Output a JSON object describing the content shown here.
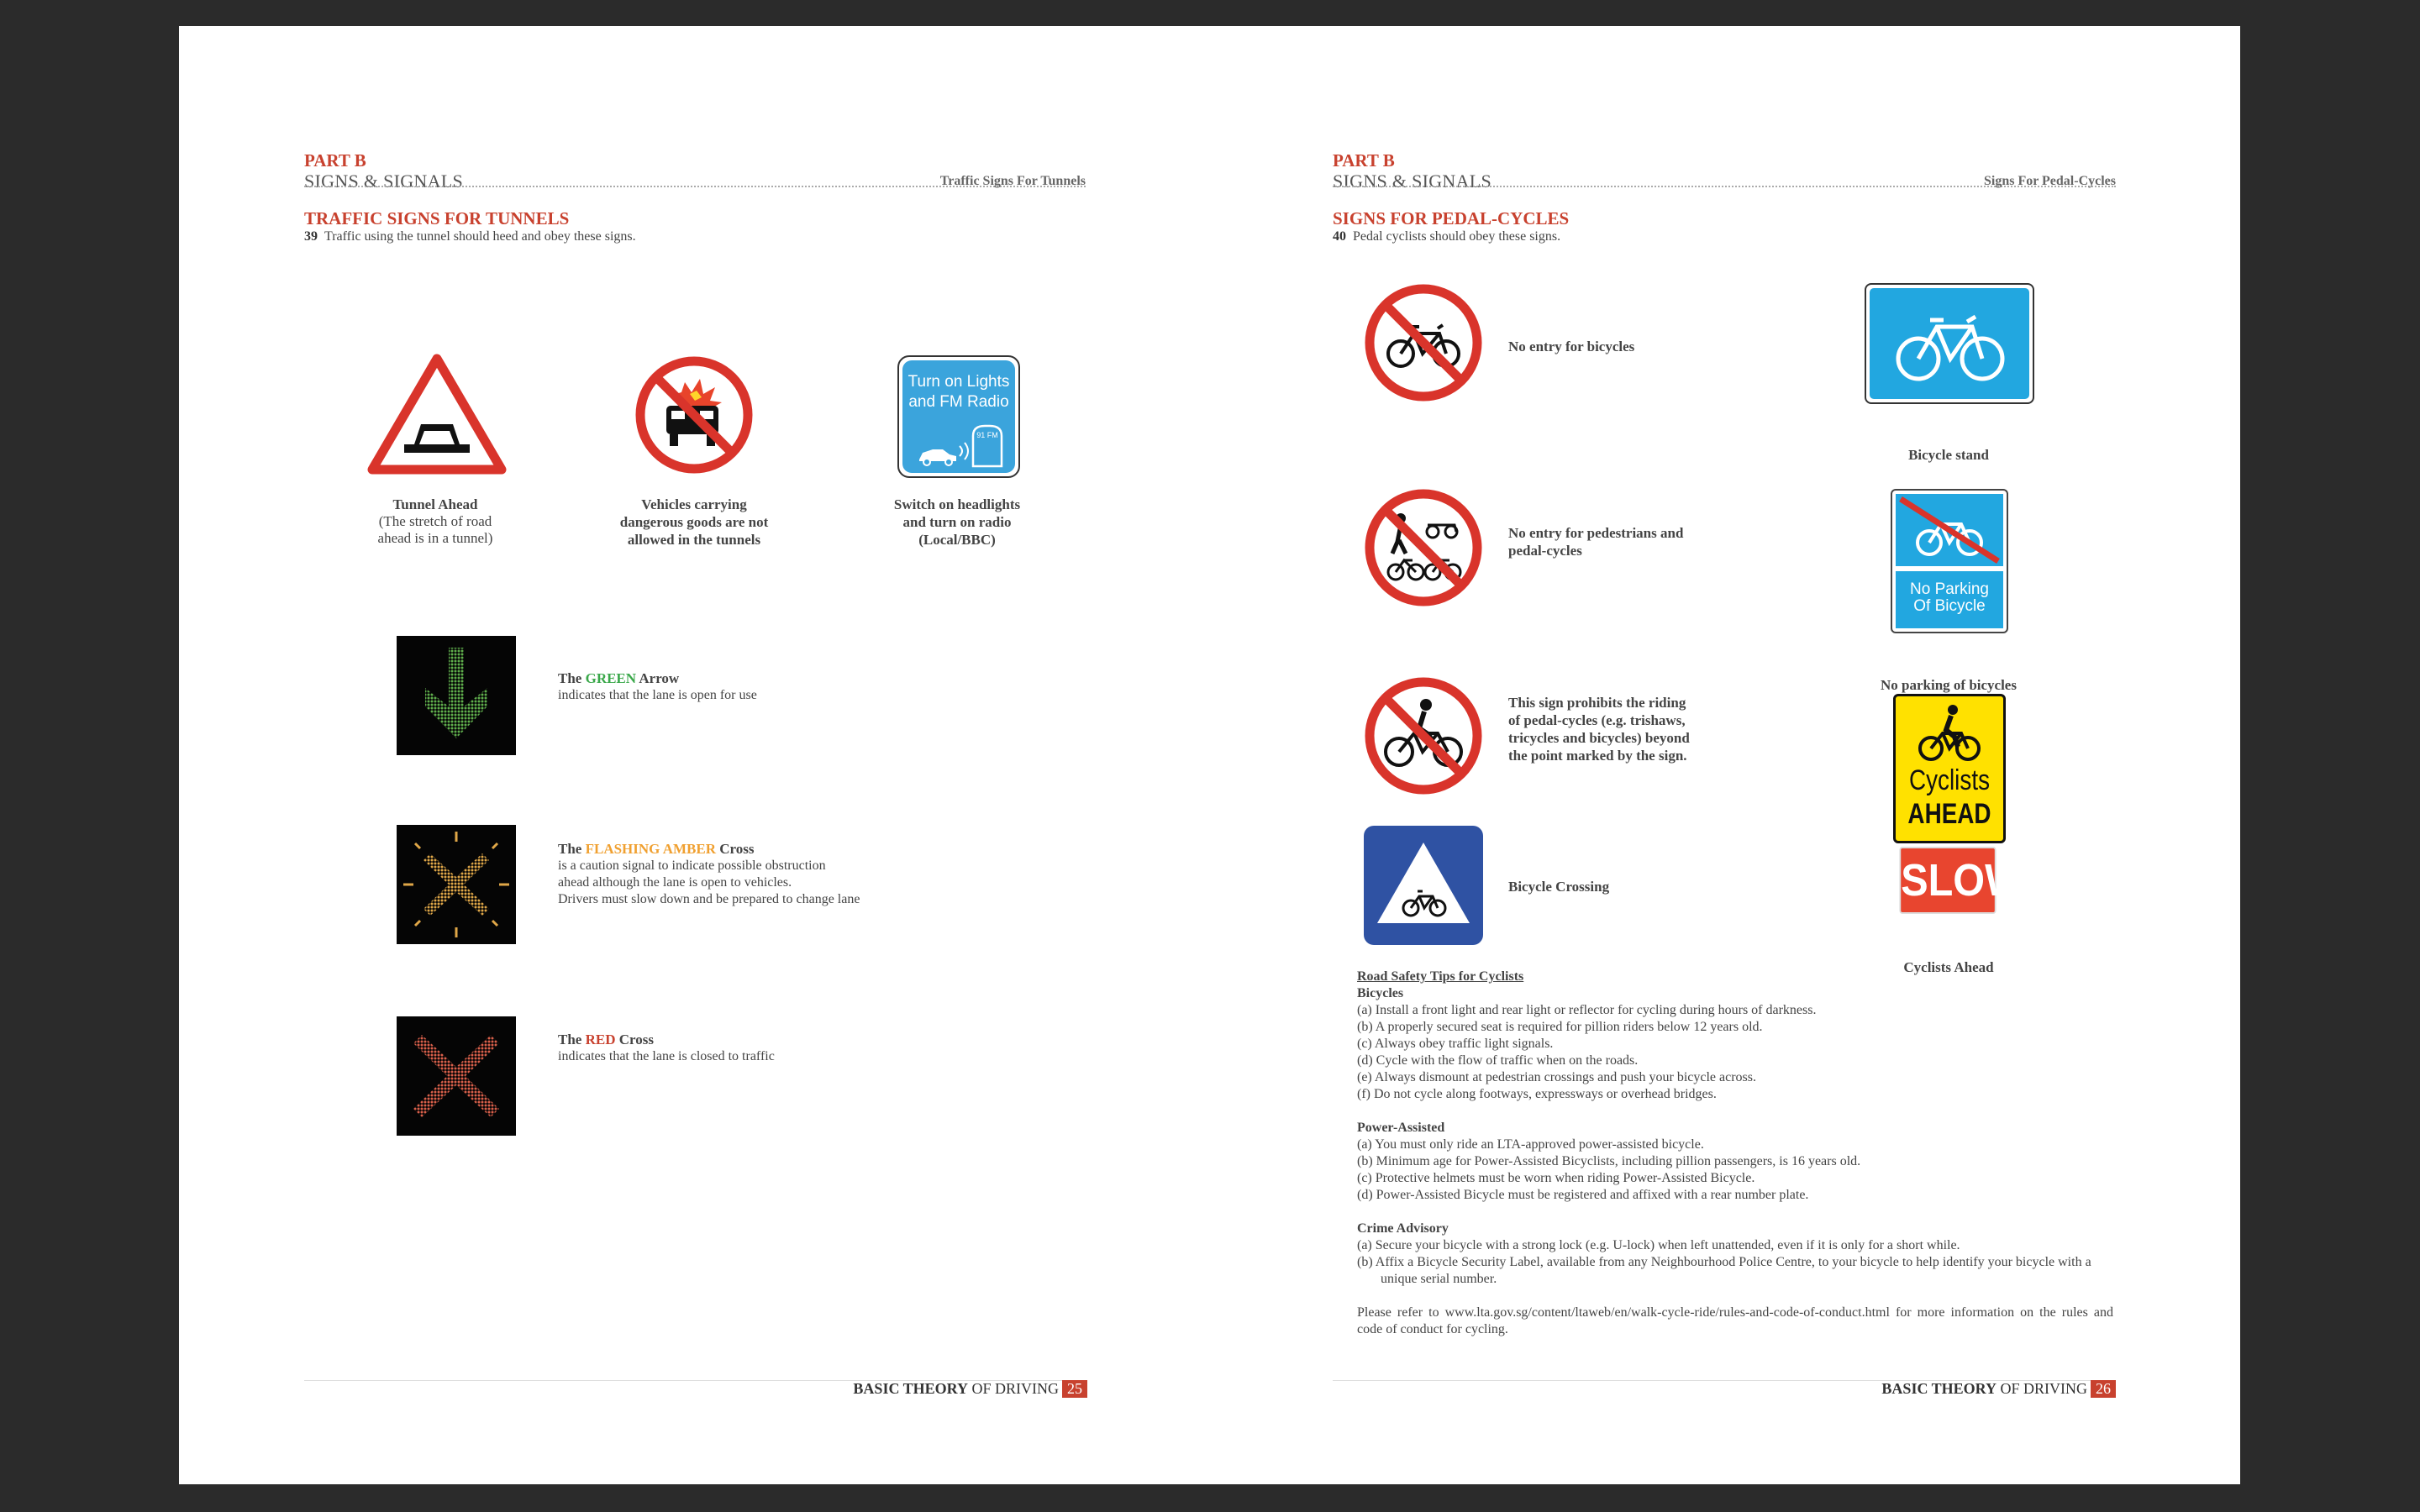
{
  "left_page": {
    "part": "PART B",
    "section": "SIGNS & SIGNALS",
    "header_right": "Traffic Signs For Tunnels",
    "title": "TRAFFIC SIGNS FOR TUNNELS",
    "intro_num": "39",
    "intro_text": "Traffic using the tunnel should heed and obey these signs.",
    "signs": [
      {
        "title": "Tunnel Ahead",
        "sub1": "(The stretch of road",
        "sub2": "ahead is in a tunnel)"
      },
      {
        "line1": "Vehicles carrying",
        "line2": "dangerous goods are not",
        "line3": "allowed in the tunnels"
      },
      {
        "line1": "Switch on headlights",
        "line2": "and turn on radio",
        "line3": "(Local/BBC)"
      }
    ],
    "radio_sign": {
      "line1": "Turn on Lights",
      "line2": "and FM Radio",
      "small": "91 FM"
    },
    "lights": [
      {
        "pre": "The ",
        "color_word": "GREEN",
        "post": " Arrow",
        "desc1": "indicates that the lane is open for use"
      },
      {
        "pre": "The ",
        "color_word": "FLASHING AMBER",
        "post": " Cross",
        "desc1": "is a caution signal to indicate possible obstruction",
        "desc2": "ahead although the lane is open to vehicles.",
        "desc3": "Drivers must slow down and be prepared to change lane"
      },
      {
        "pre": "The ",
        "color_word": "RED",
        "post": " Cross",
        "desc1": "indicates that the lane is closed to traffic"
      }
    ],
    "footer": {
      "bold": "BASIC THEORY",
      "rest": " OF DRIVING",
      "page": "25"
    }
  },
  "right_page": {
    "part": "PART B",
    "section": "SIGNS & SIGNALS",
    "header_right": "Signs For Pedal-Cycles",
    "title": "SIGNS FOR PEDAL-CYCLES",
    "intro_num": "40",
    "intro_text": "Pedal cyclists should obey these signs.",
    "left_signs": [
      {
        "line1": "No entry for bicycles"
      },
      {
        "line1": "No entry for pedestrians and",
        "line2": "pedal-cycles"
      },
      {
        "line1": "This sign prohibits the riding",
        "line2": "of pedal-cycles (e.g. trishaws,",
        "line3": "tricycles and bicycles) beyond",
        "line4": "the point marked by the sign."
      },
      {
        "line1": "Bicycle Crossing"
      }
    ],
    "right_signs": [
      {
        "label": "Bicycle stand"
      },
      {
        "label": "No parking of bicycles",
        "panel1": "No Parking",
        "panel2": "Of Bicycle"
      },
      {
        "label": "Cyclists Ahead",
        "panel1": "Cyclists",
        "panel2": "AHEAD",
        "panel3": "SLOW"
      }
    ],
    "tips": {
      "title": "Road Safety Tips for Cyclists",
      "bicycles_head": "Bicycles",
      "bicycles": [
        "(a)  Install a front light and rear light or reflector for cycling during hours of darkness.",
        "(b)  A properly secured seat is required for pillion riders below 12 years old.",
        "(c)  Always obey traffic light signals.",
        "(d)  Cycle with the flow of traffic when on the roads.",
        "(e)  Always dismount at pedestrian crossings and push your bicycle across.",
        "(f)   Do not cycle along footways, expressways or overhead bridges."
      ],
      "power_head": "Power-Assisted",
      "power": [
        "(a)  You must only ride an LTA-approved power-assisted bicycle.",
        "(b)  Minimum age for Power-Assisted Bicyclists, including pillion passengers, is 16 years old.",
        "(c)  Protective helmets must be worn when riding Power-Assisted Bicycle.",
        "(d)  Power-Assisted Bicycle must be registered and affixed with a rear number plate."
      ],
      "crime_head": "Crime Advisory",
      "crime": [
        "(a)  Secure your bicycle with a strong lock (e.g. U-lock) when left unattended, even if it is only for a short while.",
        "(b)  Affix a Bicycle Security Label, available from any Neighbourhood Police Centre, to your bicycle to help identify your bicycle with a unique serial number."
      ],
      "refer": "Please refer to www.lta.gov.sg/content/ltaweb/en/walk-cycle-ride/rules-and-code-of-conduct.html for more information on the rules and code of conduct for cycling."
    },
    "footer": {
      "bold": "BASIC THEORY",
      "rest": " OF DRIVING",
      "page": "26"
    }
  }
}
